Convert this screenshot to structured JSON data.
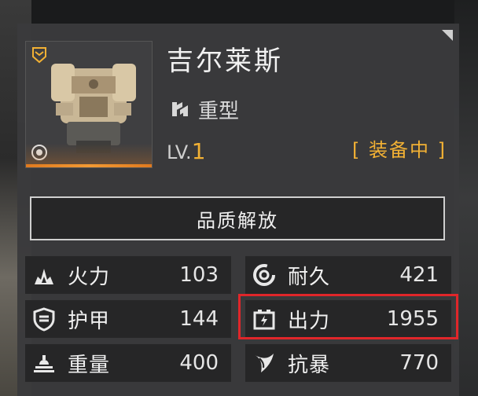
{
  "unit": {
    "name": "吉尔莱斯",
    "type_label": "重型",
    "level_prefix": "LV.",
    "level_value": "1",
    "status": "[ 装备中 ]"
  },
  "actions": {
    "release_label": "品质解放"
  },
  "stats": [
    {
      "label": "火力",
      "value": "103",
      "icon": "firepower-icon"
    },
    {
      "label": "耐久",
      "value": "421",
      "icon": "durability-icon"
    },
    {
      "label": "护甲",
      "value": "144",
      "icon": "armor-icon"
    },
    {
      "label": "出力",
      "value": "1955",
      "icon": "power-output-icon"
    },
    {
      "label": "重量",
      "value": "400",
      "icon": "weight-icon"
    },
    {
      "label": "抗暴",
      "value": "770",
      "icon": "crit-resist-icon"
    }
  ],
  "colors": {
    "accent_gold": "#f2b134",
    "accent_orange": "#e07a1f",
    "highlight_red": "#e0262a",
    "panel_bg": "#3a3a3c",
    "cell_bg": "#262627"
  }
}
